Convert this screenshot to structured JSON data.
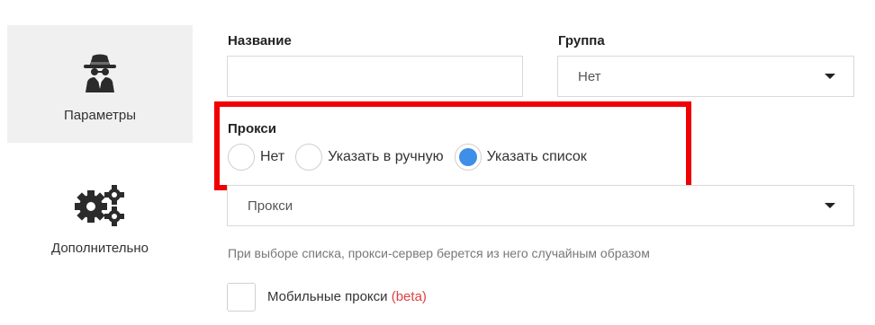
{
  "sidebar": {
    "items": [
      {
        "label": "Параметры",
        "icon": "incognito-spy-icon",
        "active": true
      },
      {
        "label": "Дополнительно",
        "icon": "gears-icon",
        "active": false
      }
    ]
  },
  "form": {
    "name": {
      "label": "Название",
      "value": ""
    },
    "group": {
      "label": "Группа",
      "value": "Нет"
    },
    "proxy": {
      "label": "Прокси",
      "options": [
        "Нет",
        "Указать в ручную",
        "Указать список"
      ],
      "selected": "Указать список"
    },
    "proxy_list": {
      "value": "Прокси"
    },
    "hint": "При выборе списка, прокси-сервер берется из него случайным образом",
    "mobile_proxy": {
      "label": "Мобильные прокси",
      "badge": "(beta)",
      "checked": false
    }
  },
  "colors": {
    "highlight": "#f00000",
    "radio_checked": "#3d8fe8",
    "beta": "#e04040",
    "active_tab_bg": "#f0f0f0"
  }
}
